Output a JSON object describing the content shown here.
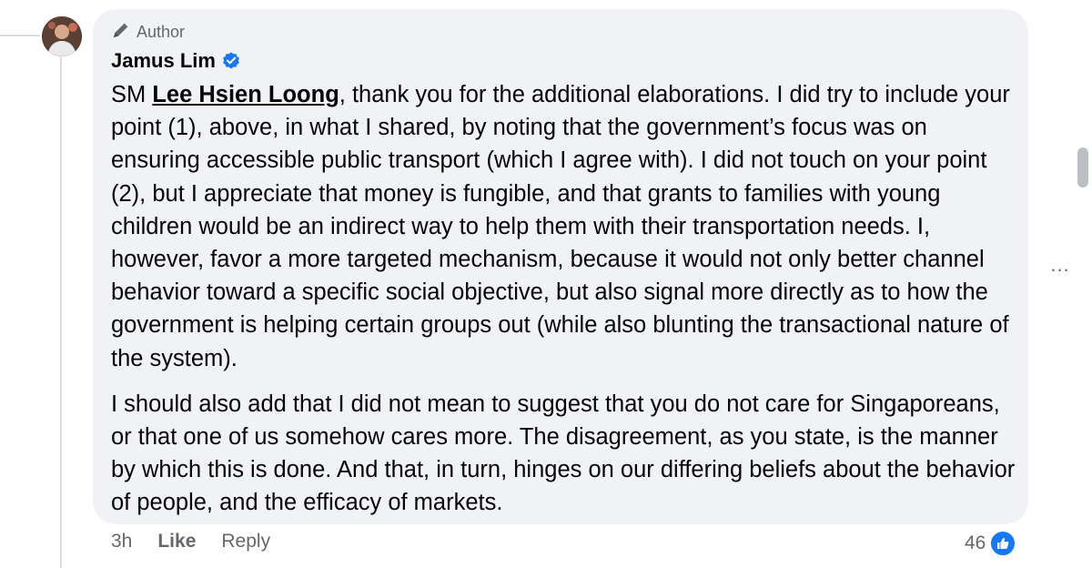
{
  "comment": {
    "author_tag": "Author",
    "author_name": "Jamus Lim",
    "verified": true,
    "mention_prefix": "SM",
    "mention": "Lee Hsien Loong",
    "paragraph1_rest": ", thank you for the additional elaborations. I did try to include your point (1), above, in what I shared, by noting that the government’s focus was on ensuring accessible public transport (which I agree with). I did not touch on your point (2), but I appreciate that money is fungible, and that grants to families with young children would be an indirect way to help them with their transportation needs. I, however, favor a more targeted mechanism, because it would not only better channel behavior toward a specific social objective, but also signal more directly as to how the government is helping certain groups out (while also blunting the transactional nature of the system).",
    "paragraph2": "I should also add that I did not mean to suggest that you do not care for Singaporeans, or that one of us somehow cares more. The disagreement, as you state, is the manner by which this is done. And that, in turn, hinges on our differing beliefs about the behavior of people, and the efficacy of markets."
  },
  "actions": {
    "time": "3h",
    "like_label": "Like",
    "reply_label": "Reply"
  },
  "reactions": {
    "count": "46",
    "icon": "thumbs-up-icon"
  },
  "more_options": {
    "label": "...",
    "icon": "more-horizontal-icon"
  },
  "colors": {
    "bubble_bg": "#f0f2f5",
    "secondary_text": "#65676b",
    "facebook_blue": "#1877f2"
  }
}
